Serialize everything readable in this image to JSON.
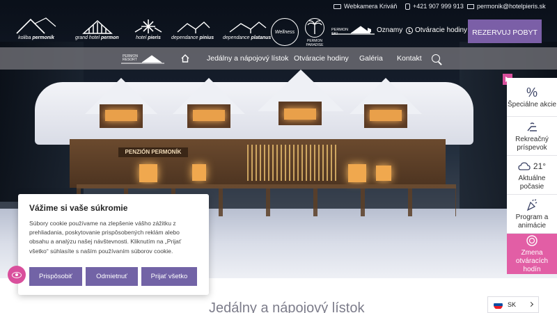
{
  "colors": {
    "accent_purple": "#7b5fa7",
    "accent_pink": "#e25ea5",
    "cookie_button": "#7263a6",
    "nav_bg": "#6e6e74"
  },
  "header": {
    "logos": [
      {
        "name": "koliba-permonik-logo",
        "line1": "koliba",
        "line2": "permoník"
      },
      {
        "name": "grand-hotel-permon-logo",
        "line1": "grand hotel",
        "line2": "permon"
      },
      {
        "name": "hotel-pieris-logo",
        "line1": "hotel",
        "line2": "pieris"
      },
      {
        "name": "dependance-pinius-logo",
        "line1": "dependance",
        "line2": "pinius"
      },
      {
        "name": "dependance-platanus-logo",
        "line1": "dependance",
        "line2": "platanus"
      },
      {
        "name": "wellness-logo",
        "line1": "Wellness",
        "line2": ""
      },
      {
        "name": "permon-paradise-logo",
        "line1": "PERMON",
        "line2": "PARADISE"
      },
      {
        "name": "permon-ski-logo",
        "line1": "PERMON",
        "line2": "SKI"
      }
    ],
    "contacts": {
      "webcam": "Webkamera Kriváň",
      "phone": "+421 907 999 913",
      "email": "permonik@hotelpieris.sk"
    },
    "links": {
      "announcements": "Oznamy",
      "opening_hours": "Otváracie hodiny"
    },
    "reserve_button": "REZERVUJ POBYT",
    "resort_logo": {
      "line1": "PERMON",
      "line2": "RESORT"
    }
  },
  "nav": {
    "items": [
      "Jedálny a nápojový lístok",
      "Otváracie hodiny",
      "Galéria",
      "Kontakt"
    ],
    "home_icon": "home-icon",
    "search_icon": "search-icon"
  },
  "hero": {
    "sign": "PENZIÓN PERMONÍK"
  },
  "side_panel": {
    "items": [
      {
        "icon": "percent-icon",
        "label": "Špeciálne akcie"
      },
      {
        "icon": "lounger-icon",
        "label": "Rekreačný príspevok"
      },
      {
        "icon": "weather-icon",
        "temperature": "21°",
        "label": "Aktuálne počasie"
      },
      {
        "icon": "party-icon",
        "label": "Program a animácie"
      },
      {
        "icon": "clock-change-icon",
        "label": "Zmena otváracích hodín"
      }
    ]
  },
  "cookie": {
    "title": "Vážime si vaše súkromie",
    "text": "Súbory cookie používame na zlepšenie vášho zážitku z prehliadania, poskytovanie prispôsobených reklám alebo obsahu a analýzu našej návštevnosti. Kliknutím na „Prijať všetko“ súhlasíte s naším používaním súborov cookie.",
    "buttons": {
      "customize": "Prispôsobiť",
      "reject": "Odmietnuť",
      "accept": "Prijať všetko"
    }
  },
  "page": {
    "heading": "Jedálny a nápojový lístok"
  },
  "language": {
    "current": "SK"
  }
}
